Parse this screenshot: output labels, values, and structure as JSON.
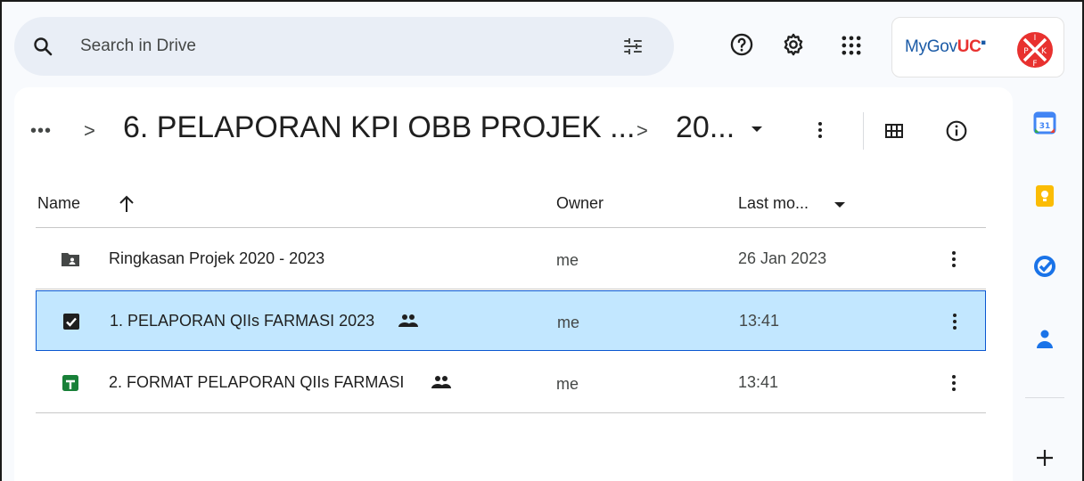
{
  "search": {
    "placeholder": "Search in Drive"
  },
  "account": {
    "brand_prefix": "MyGov",
    "brand_suffix": "UC",
    "avatar_letters": "IPKF"
  },
  "breadcrumb": {
    "more": "•••",
    "separator": ">",
    "folder": "6. PELAPORAN KPI OBB PROJEK ...",
    "current": "20..."
  },
  "table": {
    "headers": {
      "name": "Name",
      "owner": "Owner",
      "modified": "Last mo..."
    },
    "rows": [
      {
        "name": "Ringkasan Projek 2020 - 2023",
        "owner": "me",
        "modified": "26 Jan 2023",
        "icon": "shared-folder-icon",
        "shared": false,
        "selected": false
      },
      {
        "name": "1. PELAPORAN QIIs FARMASI 2023",
        "owner": "me",
        "modified": "13:41",
        "icon": "checkbox-checked-icon",
        "shared": true,
        "selected": true
      },
      {
        "name": "2. FORMAT PELAPORAN QIIs FARMASI",
        "owner": "me",
        "modified": "13:41",
        "icon": "google-sheets-icon",
        "shared": true,
        "selected": false
      }
    ]
  },
  "colors": {
    "selected_row": "#c2e7ff",
    "selected_border": "#0b57d0",
    "search_bg": "#e9eef6",
    "sheets_green": "#188038"
  }
}
